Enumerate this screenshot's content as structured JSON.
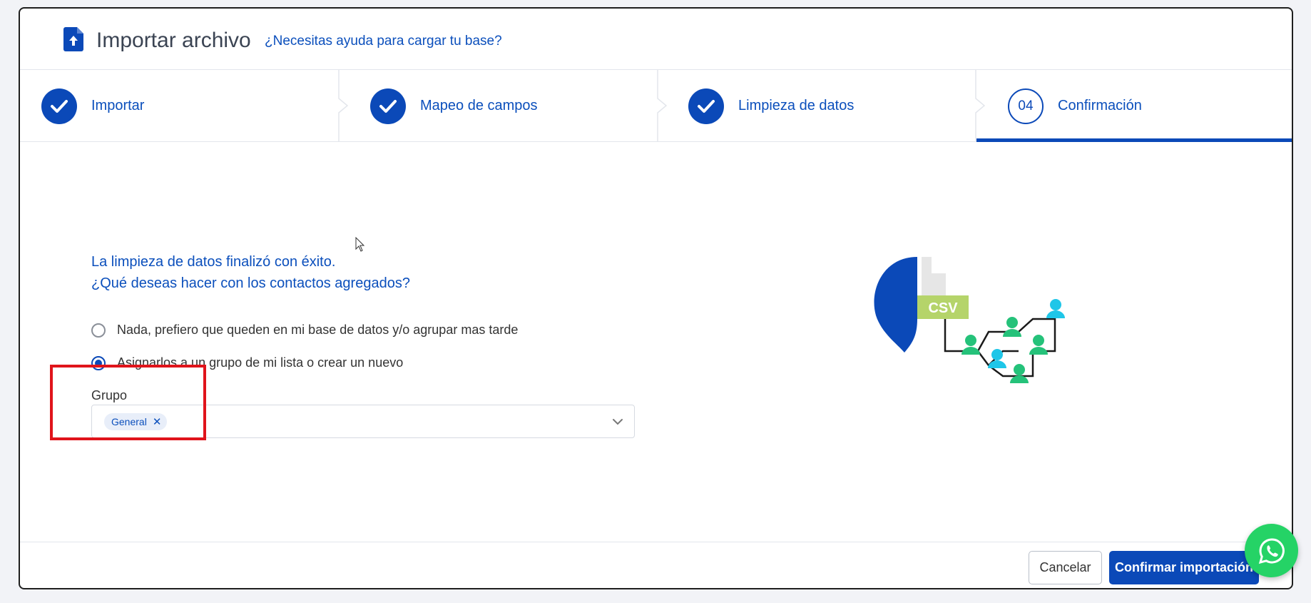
{
  "header": {
    "title": "Importar archivo",
    "help_link": "¿Necesitas ayuda para cargar tu base?",
    "icon": "file-upload-icon"
  },
  "stepper": {
    "steps": [
      {
        "label": "Importar",
        "state": "done",
        "icon": "check-icon"
      },
      {
        "label": "Mapeo de campos",
        "state": "done",
        "icon": "check-icon"
      },
      {
        "label": "Limpieza de datos",
        "state": "done",
        "icon": "check-icon"
      },
      {
        "label": "Confirmación",
        "state": "active",
        "number": "04"
      }
    ]
  },
  "content": {
    "question_line1": "La limpieza de datos finalizó con éxito.",
    "question_line2": "¿Qué deseas hacer con los contactos agregados?",
    "options": [
      {
        "label": "Nada, prefiero que queden en mi base de datos y/o agrupar mas tarde",
        "checked": false
      },
      {
        "label": "Asignarlos a un grupo de mi lista o crear un nuevo",
        "checked": true
      }
    ],
    "group_label": "Grupo",
    "group_selected": [
      "General"
    ],
    "illustration_text": "CSV"
  },
  "footer": {
    "cancel_label": "Cancelar",
    "confirm_label": "Confirmar importación"
  },
  "colors": {
    "primary": "#0b49b8",
    "link": "#0b4fbc",
    "highlight": "#e0141b",
    "whatsapp": "#25d366",
    "csv_badge": "#b5d46a",
    "people_green": "#25c27a",
    "people_cyan": "#1fc6e8"
  }
}
